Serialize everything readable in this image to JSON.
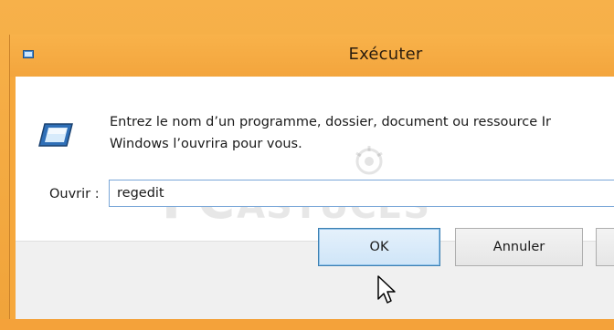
{
  "window": {
    "title": "Exécuter"
  },
  "dialog": {
    "description_line1": "Entrez le nom d’un programme, dossier, document ou ressource Ir",
    "description_line2": "Windows l’ouvrira pour vous.",
    "open_label": "Ouvrir :",
    "open_value": "regedit"
  },
  "buttons": {
    "ok_label": "OK",
    "cancel_label": "Annuler"
  },
  "watermark": {
    "text_pc": "PC",
    "text_astuces": "ASTUCES"
  },
  "icons": {
    "title": "run-icon",
    "main": "run-icon",
    "cursor": "arrow-cursor-icon"
  },
  "colors": {
    "frame": "#f6a83c",
    "focus_border": "#3c7fb1",
    "input_border": "#7aa7d8"
  }
}
